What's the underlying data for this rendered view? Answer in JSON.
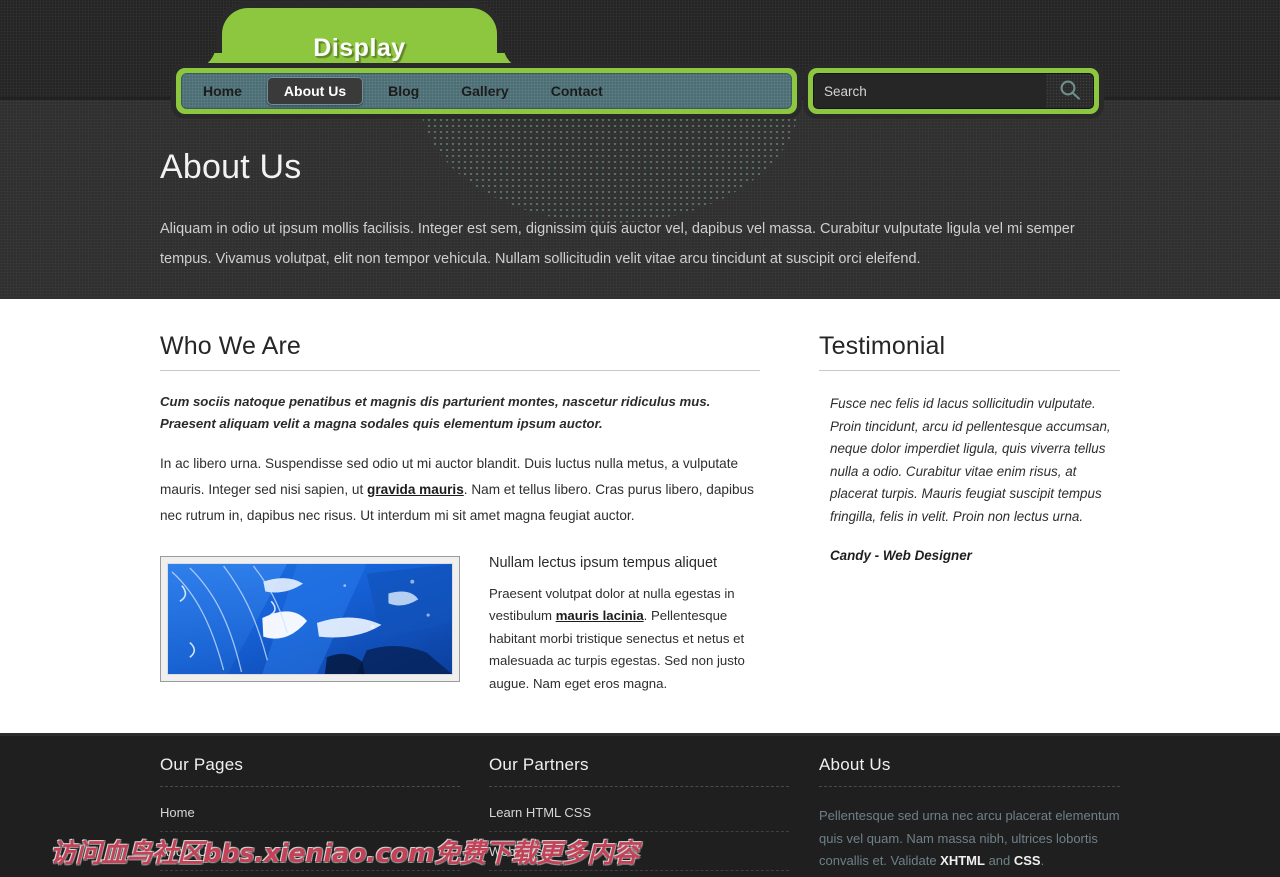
{
  "site": {
    "logo": "Display",
    "brand_color": "#8dc63f",
    "nav_color": "#52757c"
  },
  "nav": {
    "items": [
      {
        "label": "Home",
        "active": false
      },
      {
        "label": "About Us",
        "active": true
      },
      {
        "label": "Blog",
        "active": false
      },
      {
        "label": "Gallery",
        "active": false
      },
      {
        "label": "Contact",
        "active": false
      }
    ]
  },
  "search": {
    "value": "",
    "placeholder": "Search",
    "icon": "magnifier-icon"
  },
  "hero": {
    "title": "About Us",
    "text": "Aliquam in odio ut ipsum mollis facilisis. Integer est sem, dignissim quis auctor vel, dapibus vel massa. Curabitur vulputate ligula vel mi semper tempus. Vivamus volutpat, elit non tempor vehicula. Nullam sollicitudin velit vitae arcu tincidunt at suscipit orci eleifend."
  },
  "main": {
    "left": {
      "heading": "Who We Are",
      "lead": "Cum sociis natoque penatibus et magnis dis parturient montes, nascetur ridiculus mus. Praesent aliquam velit a magna sodales quis elementum ipsum auctor.",
      "body_1": "In ac libero urna. Suspendisse sed odio ut mi auctor blandit. Duis luctus nulla metus, a vulputate mauris. Integer sed nisi sapien, ut ",
      "body_link": "gravida mauris",
      "body_2": ". Nam et tellus libero. Cras purus libero, dapibus nec rutrum in, dapibus nec risus. Ut interdum mi sit amet magna feugiat auctor.",
      "media": {
        "image_alt": "blue-abstract-water-photo",
        "title": "Nullam lectus ipsum tempus aliquet",
        "text_1": "Praesent volutpat dolor at nulla egestas in vestibulum ",
        "text_link": "mauris lacinia",
        "text_2": ". Pellentesque habitant morbi tristique senectus et netus et malesuada ac turpis egestas. Sed non justo augue. Nam eget eros magna."
      }
    },
    "right": {
      "heading": "Testimonial",
      "quote": "Fusce nec felis id lacus sollicitudin vulputate. Proin tincidunt, arcu id pellentesque accumsan, neque dolor imperdiet ligula, quis viverra tellus nulla a odio. Curabitur vitae enim risus, at placerat turpis. Mauris feugiat suscipit tempus fringilla, felis in velit. Proin non lectus urna.",
      "cite": "Candy - Web Designer"
    }
  },
  "footer": {
    "col1": {
      "heading": "Our Pages",
      "links": [
        "Home",
        "About Us"
      ]
    },
    "col2": {
      "heading": "Our Partners",
      "links": [
        "Learn HTML CSS",
        "Web Design"
      ]
    },
    "col3": {
      "heading": "About Us",
      "text_1": "Pellentesque sed urna nec arcu placerat elementum quis vel quam. Nam massa nibh, ultrices lobortis convallis et. Validate ",
      "link_1": "XHTML",
      "text_2": " and ",
      "link_2": "CSS",
      "text_3": "."
    }
  },
  "watermark": {
    "text": "访问血鸟社区bbs.xieniao.com免费下载更多内容"
  }
}
